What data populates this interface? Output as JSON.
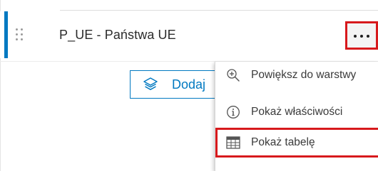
{
  "layer": {
    "title": "P_UE - Państwa UE"
  },
  "actions": {
    "more_label": "...",
    "add_label": "Dodaj"
  },
  "menu": {
    "items": [
      {
        "label": "Powiększ do warstwy",
        "icon": "zoom-in-icon"
      },
      {
        "label": "Pokaż właściwości",
        "icon": "info-icon"
      },
      {
        "label": "Pokaż tabelę",
        "icon": "table-icon"
      }
    ]
  },
  "colors": {
    "accent": "#0079c1",
    "highlight_border": "#d7191c"
  }
}
